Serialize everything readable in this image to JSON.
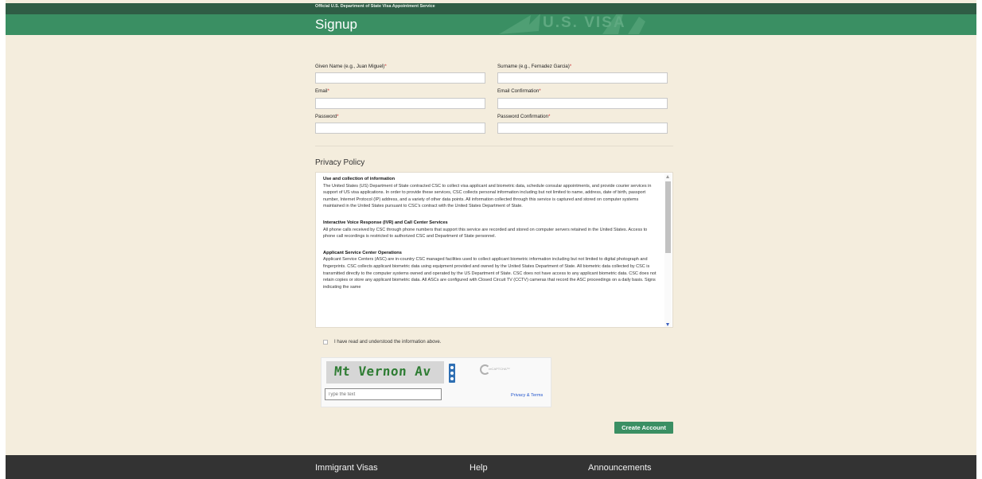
{
  "header": {
    "official_text": "Official U.S. Department of State Visa Appointment Service",
    "title": "Signup",
    "watermark_text": "U.S. VISA"
  },
  "form": {
    "given_name_label": "Given Name (e.g., Juan Miguel)",
    "surname_label": "Surname (e.g., Fernadez Garcia)",
    "email_label": "Email",
    "email_confirmation_label": "Email Confirmation",
    "password_label": "Password",
    "password_confirmation_label": "Password Confirmation",
    "required_marker": "*",
    "required_color": "#cc3333"
  },
  "privacy": {
    "title": "Privacy Policy",
    "sections": [
      {
        "heading": "Use and collection of information",
        "body": "The United States (US) Department of State contracted CSC to collect visa applicant and biometric data, schedule consular appointments, and provide courier services in support of US visa applications. In order to provide these services, CSC collects personal information including but not limited to name, address, date of birth, passport number, Internet Protocol (IP) address, and a variety of other data points. All information collected through this service is captured and stored on computer systems maintained in the United States pursuant to CSC's contract with the United States Department of State."
      },
      {
        "heading": "Interactive Voice Response (IVR) and Call Center Services",
        "body": "All phone calls received by CSC through phone numbers that support this service are recorded and stored on computer servers retained in the United States. Access to phone call recordings is restricted to authorized CSC and Department of State personnel."
      },
      {
        "heading": "Applicant Service Center Operations",
        "body": "Applicant Service Centers (ASC) are in-country CSC managed facilities used to collect applicant biometric information including but not limited to digital photograph and fingerprints. CSC collects applicant biometric data using equipment provided and owned by the United States Department of State. All biometric data collected by CSC is transmitted directly to the computer systems owned and operated by the US Department of State. CSC does not have access to any applicant biometric data. CSC does not retain copies or store any applicant biometric data. All ASCs are configured with Closed Circuit TV (CCTV) cameras that record the ASC proceedings on a daily basis. Signs indicating the same"
      }
    ],
    "acknowledge_label": "I have read and understood the information above."
  },
  "captcha": {
    "challenge_text": "Mt Vernon Av",
    "input_placeholder": "Type the text",
    "privacy_link": "Privacy & Terms",
    "logo_text": "reCAPTCHA™"
  },
  "actions": {
    "create_account": "Create Account"
  },
  "footer": {
    "links": [
      "Immigrant Visas",
      "Help",
      "Announcements"
    ]
  },
  "colors": {
    "header_green": "#3a8f63",
    "top_bar": "#2f5d45",
    "page_bg": "#f4eddd",
    "footer_bg": "#333333",
    "button_green": "#3a8f63"
  }
}
